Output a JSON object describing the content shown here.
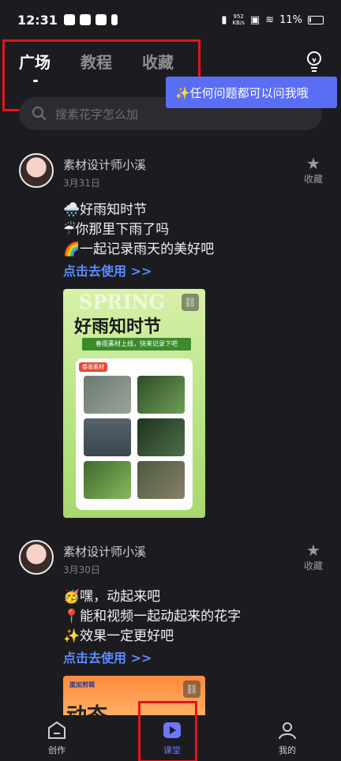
{
  "statusbar": {
    "time": "12:31",
    "speed_top": "952",
    "speed_bottom": "KB/s",
    "battery": "11%"
  },
  "tabs": [
    {
      "label": "广场"
    },
    {
      "label": "教程"
    },
    {
      "label": "收藏"
    }
  ],
  "tooltip": "✨任何问题都可以问我哦",
  "search": {
    "placeholder": "搜素花字怎么加"
  },
  "posts": [
    {
      "author": "素材设计师小溪",
      "date": "3月31日",
      "fav_label": "收藏",
      "lines": [
        "🌧️好雨知时节",
        "☔你那里下雨了吗",
        "🌈一起记录雨天的美好吧"
      ],
      "link": "点击去使用 >>",
      "thumb": {
        "spring": "SPRING",
        "title": "好雨知时节",
        "sub": "春雨素材上线，快来记录下吧",
        "tag": "春雨素材"
      }
    },
    {
      "author": "素材设计师小溪",
      "date": "3月30日",
      "fav_label": "收藏",
      "lines": [
        "🥳嘿，动起来吧",
        "📍能和视频一起动起来的花字",
        "✨效果一定更好吧"
      ],
      "link": "点击去使用 >>",
      "thumb": {
        "brand": "度加剪辑",
        "big": "动态"
      }
    }
  ],
  "nav": [
    {
      "label": "创作"
    },
    {
      "label": "课堂"
    },
    {
      "label": "我的"
    }
  ],
  "colors": {
    "accent": "#5a6ef5",
    "link": "#5a8bff",
    "highlight_box": "#e3141b"
  }
}
